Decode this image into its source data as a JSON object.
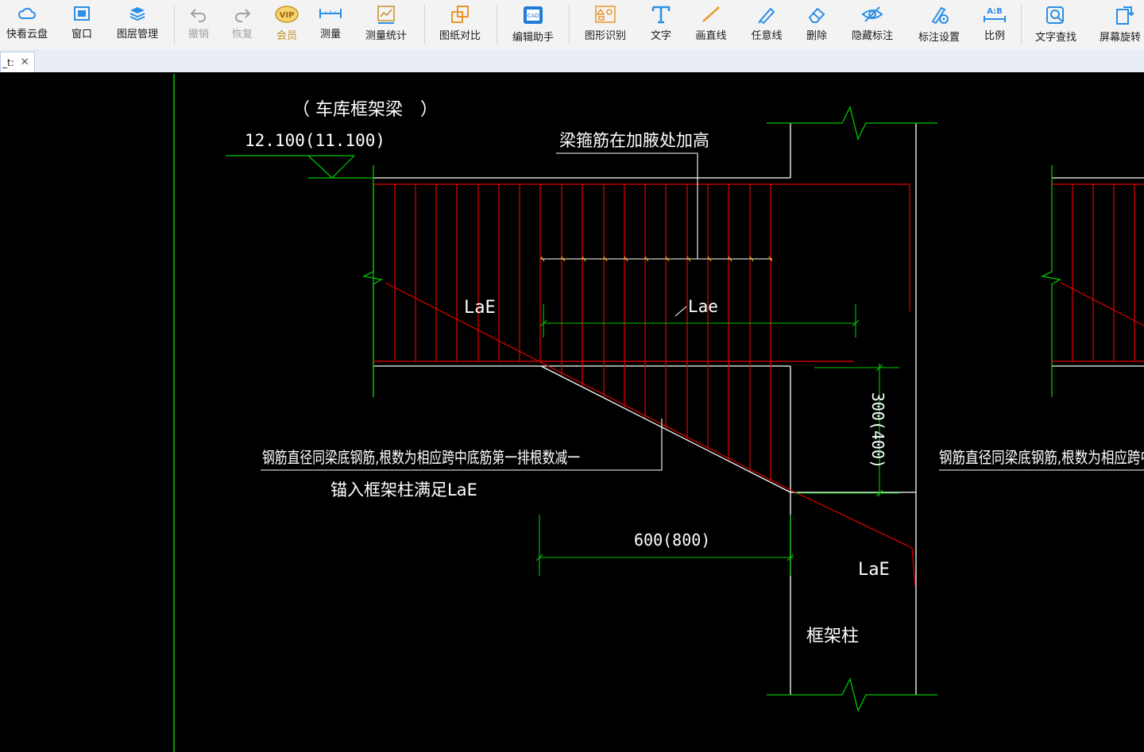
{
  "toolbar": {
    "items": [
      {
        "label": "快看云盘",
        "icon": "cloud-icon"
      },
      {
        "label": "窗口",
        "icon": "window-icon"
      },
      {
        "label": "图层管理",
        "icon": "layers-icon"
      },
      {
        "label": "撤销",
        "icon": "undo-icon"
      },
      {
        "label": "恢复",
        "icon": "redo-icon"
      },
      {
        "label": "会员",
        "icon": "vip-icon"
      },
      {
        "label": "测量",
        "icon": "measure-icon"
      },
      {
        "label": "测量统计",
        "icon": "measure-stats-icon"
      },
      {
        "label": "图纸对比",
        "icon": "compare-icon"
      },
      {
        "label": "编辑助手",
        "icon": "cad-edit-icon"
      },
      {
        "label": "图形识别",
        "icon": "shape-recognize-icon"
      },
      {
        "label": "文字",
        "icon": "text-icon"
      },
      {
        "label": "画直线",
        "icon": "line-icon"
      },
      {
        "label": "任意线",
        "icon": "freehand-icon"
      },
      {
        "label": "删除",
        "icon": "eraser-icon"
      },
      {
        "label": "隐藏标注",
        "icon": "hide-eye-icon"
      },
      {
        "label": "标注设置",
        "icon": "annotation-settings-icon"
      },
      {
        "label": "比例",
        "icon": "scale-icon"
      },
      {
        "label": "文字查找",
        "icon": "text-search-icon"
      },
      {
        "label": "屏幕旋转",
        "icon": "rotate-screen-icon"
      }
    ],
    "icon_color": "#2b8fe6",
    "disabled_color": "#a0a0a0",
    "vip_color": "#c8922a"
  },
  "tab": {
    "name": "_t:",
    "close": "✕"
  },
  "drawing": {
    "title": "（ 车库框架梁　）",
    "elevation": "12.100(11.100)",
    "note_stirrup": "梁箍筋在加腋处加高",
    "lae_left": "LaE",
    "lae_middle": "Lae",
    "dim_vertical": "300(400)",
    "note_rebar_1": "钢筋直径同梁底钢筋,根数为相应跨中底筋第一排根数减一",
    "note_rebar_2": "锚入框架柱满足LaE",
    "note_rebar_right": "钢筋直径同梁底钢筋,根数为相应跨中",
    "dim_horizontal": "600(800)",
    "lae_column": "LaE",
    "column_label": "框架柱",
    "colors": {
      "background": "#000000",
      "line_white": "#ffffff",
      "line_green": "#00c800",
      "line_red": "#e00000"
    }
  }
}
